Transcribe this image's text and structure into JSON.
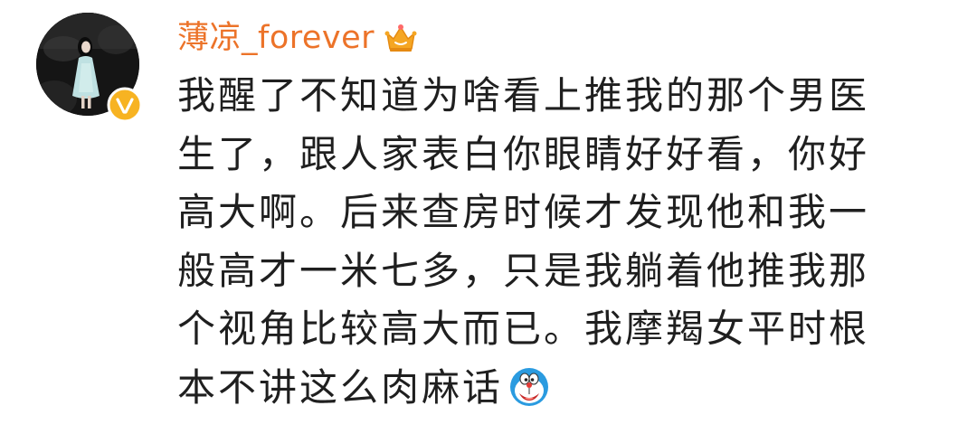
{
  "comment": {
    "username": "薄凉_forever",
    "badge_icon": "crown-icon",
    "verified_icon": "verified-v-icon",
    "avatar_icon": "user-avatar",
    "accent_color": "#ec7329",
    "text_lines": [
      "我醒了不知道为啥看上推我的那个男医",
      "生了，跟人家表白你眼睛好好看，你好",
      "高大啊。后来查房时候才发现他和我一",
      "般高才一米七多，只是我躺着他推我那",
      "个视角比较高大而已。我摩羯女平时根",
      "本不讲这么肉麻话"
    ],
    "trailing_emoji": "doraemon-emoji"
  }
}
